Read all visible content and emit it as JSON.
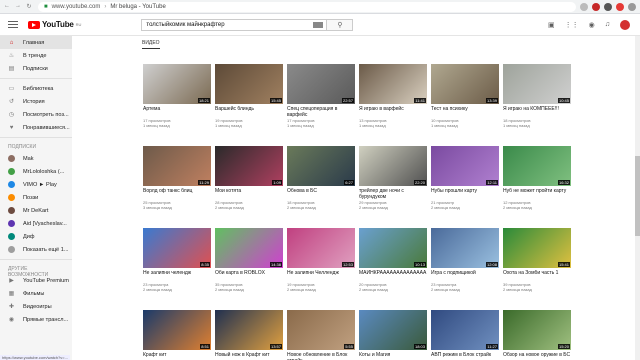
{
  "browser": {
    "url_domain": "www.youtube.com",
    "url_sep": "›",
    "page_title": "Mr beluga - YouTube"
  },
  "header": {
    "logo_text": "YouTube",
    "logo_sup": "RU",
    "search_query": "толстыйкомик майнкрафтер",
    "search_icon": "search-icon"
  },
  "sidebar": {
    "main": [
      {
        "label": "Главная",
        "icon": "home-icon",
        "active": true
      },
      {
        "label": "В тренде",
        "icon": "fire-icon"
      },
      {
        "label": "Подписки",
        "icon": "subscriptions-icon"
      }
    ],
    "library": [
      {
        "label": "Библиотека",
        "icon": "folder-icon"
      },
      {
        "label": "История",
        "icon": "history-icon"
      },
      {
        "label": "Посмотреть поз...",
        "icon": "clock-icon"
      },
      {
        "label": "Понравившиеся...",
        "icon": "like-icon"
      }
    ],
    "subs_heading": "ПОДПИСКИ",
    "subs": [
      {
        "label": "Mak",
        "color": "#8d6e63"
      },
      {
        "label": "MrLololoshka (...",
        "color": "#43a047"
      },
      {
        "label": "VIMO ► Play",
        "color": "#1e88e5"
      },
      {
        "label": "Поззи",
        "color": "#fb8c00"
      },
      {
        "label": "Mr DeKart",
        "color": "#6d4c41"
      },
      {
        "label": "Aid [Vyacheslav...",
        "color": "#5e35b1"
      },
      {
        "label": "Диф",
        "color": "#00897b"
      },
      {
        "label": "Показать ещё 1...",
        "color": "#9e9e9e"
      }
    ],
    "more_heading": "ДРУГИЕ ВОЗМОЖНОСТИ",
    "more": [
      {
        "label": "YouTube Premium",
        "icon": "youtube-icon"
      },
      {
        "label": "Фильмы",
        "icon": "film-icon"
      },
      {
        "label": "Видеоигры",
        "icon": "gamepad-icon"
      },
      {
        "label": "Прямые трансл...",
        "icon": "live-icon"
      }
    ]
  },
  "content": {
    "tab_label": "ВИДЕО",
    "rows": [
      [
        {
          "title": "Артема",
          "duration": "18:21",
          "views": "17 просмотров",
          "age": "1 месяц назад",
          "c1": "#cfcfcf",
          "c2": "#7b6a52"
        },
        {
          "title": "Варшейс блиндь",
          "duration": "15:45",
          "views": "19 просмотров",
          "age": "1 месяц назад",
          "c1": "#5d4a38",
          "c2": "#a08060"
        },
        {
          "title": "Спец спецоперация в варфейс",
          "duration": "22:57",
          "views": "17 просмотров",
          "age": "1 месяц назад",
          "c1": "#8a8a8a",
          "c2": "#5a5a5a"
        },
        {
          "title": "Я играю в варфейс",
          "duration": "11:41",
          "views": "13 просмотров",
          "age": "1 месяц назад",
          "c1": "#6b5a48",
          "c2": "#d9d0c0"
        },
        {
          "title": "Тест на психику",
          "duration": "13:39",
          "views": "10 просмотров",
          "age": "1 месяц назад",
          "c1": "#b0a890",
          "c2": "#6c5c48"
        },
        {
          "title": "Я играю на КОМПЕЕЕ!!!",
          "duration": "10:45",
          "views": "18 просмотров",
          "age": "1 месяц назад",
          "c1": "#9ea39b",
          "c2": "#d0d0d0"
        }
      ],
      [
        {
          "title": "Ворлд оф танкс блиц",
          "duration": "11:29",
          "views": "25 просмотров",
          "age": "3 месяца назад",
          "c1": "#6d5a4a",
          "c2": "#c08060"
        },
        {
          "title": "Мои котята",
          "duration": "1:09",
          "views": "28 просмотров",
          "age": "2 месяца назад",
          "c1": "#2a2a2a",
          "c2": "#b04060"
        },
        {
          "title": "Обнова в БС",
          "duration": "6:27",
          "views": "18 просмотров",
          "age": "2 месяца назад",
          "c1": "#6a7a5a",
          "c2": "#2a3a4a"
        },
        {
          "title": "трейлер две ночи с бурундуком",
          "duration": "22:20",
          "views": "29 просмотров",
          "age": "2 месяца назад",
          "c1": "#d0d0c0",
          "c2": "#505050"
        },
        {
          "title": "Нубы прошли карту",
          "duration": "12:11",
          "views": "21 просмотр",
          "age": "2 месяца назад",
          "c1": "#7a4aa0",
          "c2": "#b080d0"
        },
        {
          "title": "Нуб не может пройти карту",
          "duration": "16:32",
          "views": "12 просмотров",
          "age": "2 месяца назад",
          "c1": "#3a8a4a",
          "c2": "#80c080"
        }
      ],
      [
        {
          "title": "Не залипни челендж",
          "duration": "8:35",
          "views": "23 просмотра",
          "age": "2 месяца назад",
          "c1": "#3a7ad0",
          "c2": "#e05050"
        },
        {
          "title": "Оби карта в ROBLOX",
          "duration": "14:38",
          "views": "35 просмотров",
          "age": "2 месяца назад",
          "c1": "#60c060",
          "c2": "#d040d0"
        },
        {
          "title": "Не залипни Челлендж",
          "duration": "12:53",
          "views": "19 просмотров",
          "age": "2 месяца назад",
          "c1": "#c04080",
          "c2": "#e0a0c0"
        },
        {
          "title": "МАЙНКРАААААААААААААА",
          "duration": "10:13",
          "views": "20 просмотров",
          "age": "2 месяца назад",
          "c1": "#6aa0d0",
          "c2": "#4a7a3a"
        },
        {
          "title": "Игра с подпищикой",
          "duration": "12:08",
          "views": "23 просмотра",
          "age": "2 месяца назад",
          "c1": "#4a6a9a",
          "c2": "#9ac0e0"
        },
        {
          "title": "Охота на Зомби часть 1",
          "duration": "15:41",
          "views": "39 просмотров",
          "age": "2 месяца назад",
          "c1": "#2a8a3a",
          "c2": "#e0c040"
        }
      ],
      [
        {
          "title": "Крафт кит",
          "duration": "8:51",
          "views": "",
          "age": "",
          "c1": "#1a3a6a",
          "c2": "#e08030"
        },
        {
          "title": "Новый нож в Крафт кит",
          "duration": "13:57",
          "views": "",
          "age": "",
          "c1": "#203050",
          "c2": "#e0a040"
        },
        {
          "title": "Новое обновление в Блок страйк",
          "duration": "5:55",
          "views": "",
          "age": "",
          "c1": "#8a6a4a",
          "c2": "#c0a080"
        },
        {
          "title": "Коты и Магия",
          "duration": "18:03",
          "views": "",
          "age": "",
          "c1": "#5a8ac0",
          "c2": "#3a5a3a"
        },
        {
          "title": "АВП режим в Блок страйк",
          "duration": "11:27",
          "views": "",
          "age": "",
          "c1": "#304a80",
          "c2": "#7090c0"
        },
        {
          "title": "Обзор на новое оружие в БС",
          "duration": "15:20",
          "views": "",
          "age": "",
          "c1": "#3a6a2a",
          "c2": "#a0c080"
        }
      ]
    ]
  },
  "statusbar": {
    "text": "https://www.youtube.com/watch?v=..."
  }
}
